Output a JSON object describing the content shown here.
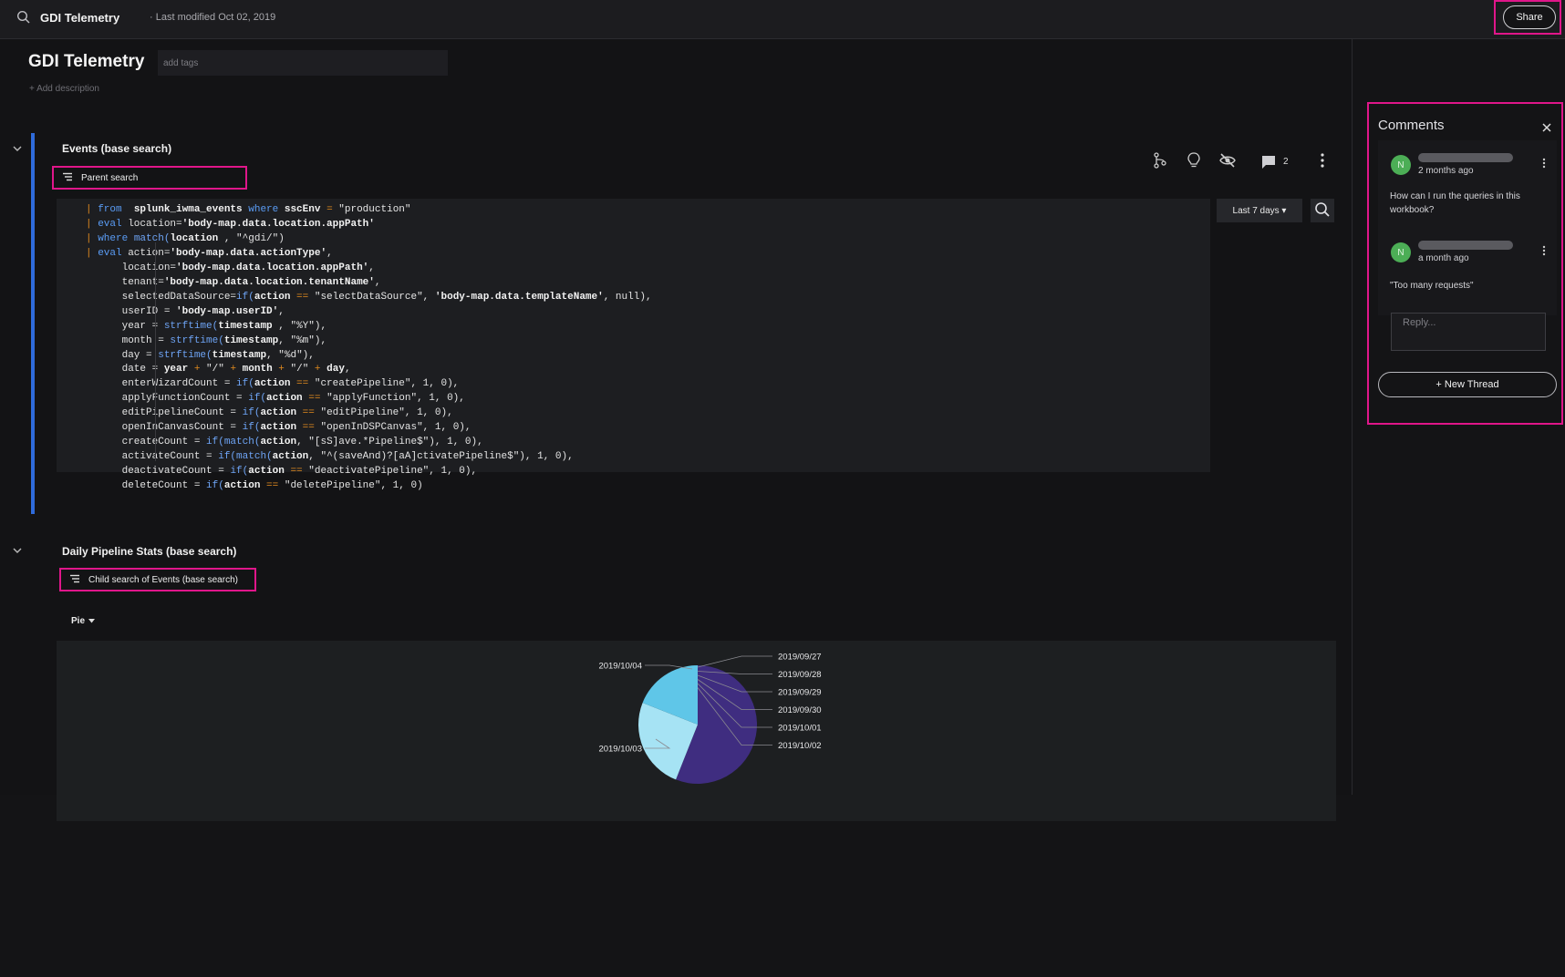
{
  "topbar": {
    "title": "GDI Telemetry",
    "modified": "· Last modified Oct 02, 2019",
    "share_label": "Share"
  },
  "workbook": {
    "title": "GDI Telemetry",
    "tags_placeholder": "add tags",
    "add_description": "+ Add description"
  },
  "section1": {
    "title": "Events (base search)",
    "source_label": "Parent search",
    "comment_count": "2",
    "time_range": "Last 7 days ▾"
  },
  "code": [
    [
      [
        "pipe",
        "| "
      ],
      [
        "kw",
        "from"
      ],
      [
        "",
        "  "
      ],
      [
        "b",
        "splunk_iwma_events"
      ],
      [
        "",
        ""
      ],
      [
        "kw",
        " where "
      ],
      [
        "b",
        "sscEnv"
      ],
      [
        "op",
        " = "
      ],
      [
        "s",
        "\"production\""
      ]
    ],
    [
      [
        "pipe",
        "| "
      ],
      [
        "kw",
        "eval"
      ],
      [
        "",
        " location="
      ],
      [
        "b",
        "'body-map.data.location.appPath'"
      ]
    ],
    [
      [
        "pipe",
        "| "
      ],
      [
        "kw",
        "where"
      ],
      [
        "fn",
        " match("
      ],
      [
        "b",
        "location"
      ],
      [
        "",
        " , \"^gdi/\")"
      ]
    ],
    [
      [
        "pipe",
        "| "
      ],
      [
        "kw",
        "eval"
      ],
      [
        "",
        " action="
      ],
      [
        "b",
        "'body-map.data.actionType'"
      ],
      [
        "",
        ","
      ]
    ],
    [
      [
        "",
        "      location="
      ],
      [
        "b",
        "'body-map.data.location.appPath'"
      ],
      [
        "",
        ","
      ]
    ],
    [
      [
        "",
        "      tenant="
      ],
      [
        "b",
        "'body-map.data.location.tenantName'"
      ],
      [
        "",
        ","
      ]
    ],
    [
      [
        "",
        "      selectedDataSource="
      ],
      [
        "fn",
        "if("
      ],
      [
        "b",
        "action"
      ],
      [
        "op",
        " == "
      ],
      [
        "s",
        "\"selectDataSource\", "
      ],
      [
        "b",
        "'body-map.data.templateName'"
      ],
      [
        "",
        ", null),"
      ]
    ],
    [
      [
        "",
        "      userID = "
      ],
      [
        "b",
        "'body-map.userID'"
      ],
      [
        "",
        ","
      ]
    ],
    [
      [
        "",
        "      year = "
      ],
      [
        "fn",
        "strftime("
      ],
      [
        "b",
        "timestamp"
      ],
      [
        "",
        " , \"%Y\"),"
      ]
    ],
    [
      [
        "",
        "      month = "
      ],
      [
        "fn",
        "strftime("
      ],
      [
        "b",
        "timestamp"
      ],
      [
        "",
        ", \"%m\"),"
      ]
    ],
    [
      [
        "",
        "      day = "
      ],
      [
        "fn",
        "strftime("
      ],
      [
        "b",
        "timestamp"
      ],
      [
        "",
        ", \"%d\"),"
      ]
    ],
    [
      [
        "",
        "      date = "
      ],
      [
        "b",
        "year"
      ],
      [
        "op",
        " + "
      ],
      [
        "",
        "\"/\""
      ],
      [
        "op",
        " + "
      ],
      [
        "b",
        "month"
      ],
      [
        "op",
        " + "
      ],
      [
        "",
        "\"/\""
      ],
      [
        "op",
        " + "
      ],
      [
        "b",
        "day"
      ],
      [
        "",
        ","
      ]
    ],
    [
      [
        "",
        "      enterWizardCount = "
      ],
      [
        "fn",
        "if("
      ],
      [
        "b",
        "action"
      ],
      [
        "op",
        " == "
      ],
      [
        "",
        "\"createPipeline\", 1, 0),"
      ]
    ],
    [
      [
        "",
        "      applyFunctionCount = "
      ],
      [
        "fn",
        "if("
      ],
      [
        "b",
        "action"
      ],
      [
        "op",
        " == "
      ],
      [
        "",
        "\"applyFunction\", 1, 0),"
      ]
    ],
    [
      [
        "",
        "      editPipelineCount = "
      ],
      [
        "fn",
        "if("
      ],
      [
        "b",
        "action"
      ],
      [
        "op",
        " == "
      ],
      [
        "",
        "\"editPipeline\", 1, 0),"
      ]
    ],
    [
      [
        "",
        "      openInCanvasCount = "
      ],
      [
        "fn",
        "if("
      ],
      [
        "b",
        "action"
      ],
      [
        "op",
        " == "
      ],
      [
        "",
        "\"openInDSPCanvas\", 1, 0),"
      ]
    ],
    [
      [
        "",
        "      createCount = "
      ],
      [
        "fn",
        "if(match("
      ],
      [
        "b",
        "action"
      ],
      [
        "",
        ", \"[sS]ave.*Pipeline$\"), 1, 0),"
      ]
    ],
    [
      [
        "",
        "      activateCount = "
      ],
      [
        "fn",
        "if(match("
      ],
      [
        "b",
        "action"
      ],
      [
        "",
        ", \"^(saveAnd)?[aA]ctivatePipeline$\"), 1, 0),"
      ]
    ],
    [
      [
        "",
        "      deactivateCount = "
      ],
      [
        "fn",
        "if("
      ],
      [
        "b",
        "action"
      ],
      [
        "op",
        " == "
      ],
      [
        "",
        "\"deactivatePipeline\", 1, 0),"
      ]
    ],
    [
      [
        "",
        "      deleteCount = "
      ],
      [
        "fn",
        "if("
      ],
      [
        "b",
        "action"
      ],
      [
        "op",
        " == "
      ],
      [
        "",
        "\"deletePipeline\", 1, 0)"
      ]
    ]
  ],
  "section2": {
    "title": "Daily Pipeline Stats (base search)",
    "source_label": "Child search of Events (base search)",
    "viz_type": "Pie"
  },
  "chart_data": {
    "type": "pie",
    "categories": [
      "2019/09/27",
      "2019/09/28",
      "2019/09/29",
      "2019/09/30",
      "2019/10/01",
      "2019/10/02",
      "2019/10/03",
      "2019/10/04"
    ],
    "values": [
      0,
      0,
      0,
      0,
      0,
      56,
      25,
      19
    ],
    "colors": [
      "#3a2a78",
      "#3a2a78",
      "#3a2a78",
      "#3a2a78",
      "#3a2a78",
      "#3f2d80",
      "#a6e3f4",
      "#5fc6e8"
    ]
  },
  "comments": {
    "title": "Comments",
    "items": [
      {
        "avatar": "N",
        "time": "2 months ago",
        "text": "How can I run the queries in this workbook?"
      },
      {
        "avatar": "N",
        "time": "a month ago",
        "text": "\"Too many requests\""
      }
    ],
    "reply_placeholder": "Reply...",
    "new_thread_label": "New Thread"
  }
}
